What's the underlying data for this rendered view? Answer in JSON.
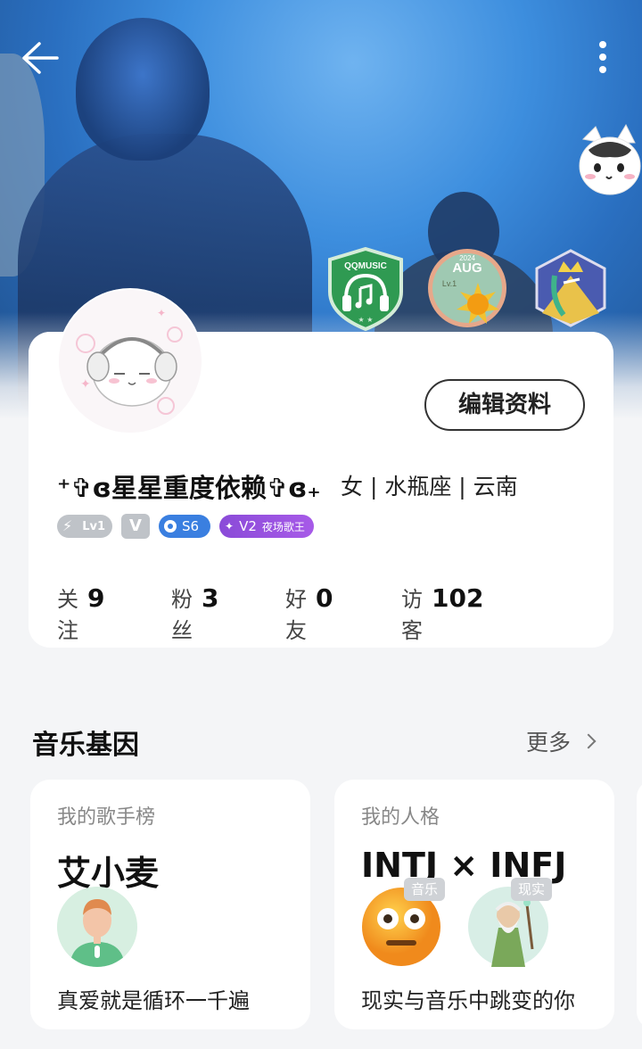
{
  "header": {
    "back_icon": "arrow-left-icon",
    "more_icon": "more-vertical-icon"
  },
  "badges": [
    {
      "name": "qqmusic-badge",
      "text": "QQMUSIC"
    },
    {
      "name": "aug-badge",
      "text": "AUG",
      "sub": "Lv.1",
      "year": "2024"
    },
    {
      "name": "crown-badge"
    }
  ],
  "profile": {
    "edit_label": "编辑资料",
    "username": "⁺✞ɞ星星重度依赖✞ɞ₊",
    "info": "女 | 水瓶座 | 云南",
    "tags": {
      "level": "Lv1",
      "v_label": "V",
      "season": "S6",
      "vip_level": "V2",
      "vip_title": "夜场歌王"
    },
    "stats": [
      {
        "label": "关注",
        "value": "9"
      },
      {
        "label": "粉丝",
        "value": "3"
      },
      {
        "label": "好友",
        "value": "0"
      },
      {
        "label": "访客",
        "value": "102"
      }
    ]
  },
  "music_dna": {
    "title": "音乐基因",
    "more_label": "更多",
    "cards": [
      {
        "subtitle": "我的歌手榜",
        "main": "艾小麦",
        "footer": "真爱就是循环一千遍"
      },
      {
        "subtitle": "我的人格",
        "main": "INTJ × INFJ",
        "footer": "现实与音乐中跳变的你",
        "tags": [
          "音乐",
          "现实"
        ]
      }
    ]
  },
  "colors": {
    "vip_purple": "#9b52e4",
    "season_blue": "#3a7fe0",
    "badge_green": "#3aa65a"
  }
}
